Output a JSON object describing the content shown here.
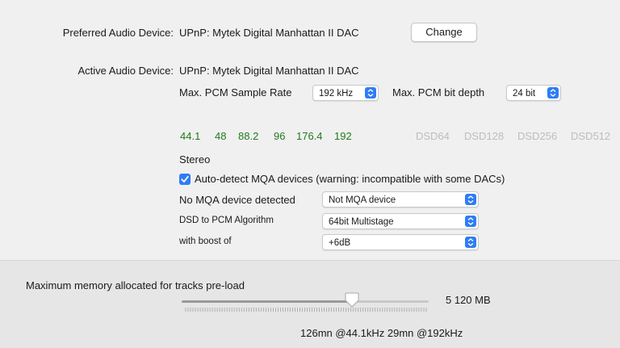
{
  "preferred": {
    "label": "Preferred Audio Device:",
    "value": "UPnP: Mytek Digital Manhattan II DAC",
    "change_button": "Change"
  },
  "active": {
    "label": "Active Audio Device:",
    "value": "UPnP: Mytek Digital Manhattan II DAC"
  },
  "pcm": {
    "rate_label": "Max. PCM Sample Rate",
    "rate_value": "192 kHz",
    "depth_label": "Max. PCM bit depth",
    "depth_value": "24 bit"
  },
  "rates": [
    "44.1",
    "48",
    "88.2",
    "96",
    "176.4",
    "192"
  ],
  "dsd_rates": [
    "DSD64",
    "DSD128",
    "DSD256",
    "DSD512"
  ],
  "channels": "Stereo",
  "mqa": {
    "autodetect_label": "Auto-detect MQA devices (warning: incompatible with some DACs)",
    "autodetect_checked": true,
    "status_label": "No MQA device detected",
    "status_value": "Not MQA device"
  },
  "dsd_to_pcm": {
    "label": "DSD to PCM Algorithm",
    "value": "64bit Multistage"
  },
  "boost": {
    "label": "with boost of",
    "value": "+6dB"
  },
  "memory": {
    "label": "Maximum memory allocated for tracks pre-load",
    "value": "5 120  MB",
    "slider_fraction": 0.69,
    "durations": "126mn @44.1kHz   29mn @192kHz"
  },
  "colors": {
    "accent": "#2f7cf6",
    "rate_green": "#1f7a1f",
    "dsd_gray": "#bdbdbd"
  }
}
